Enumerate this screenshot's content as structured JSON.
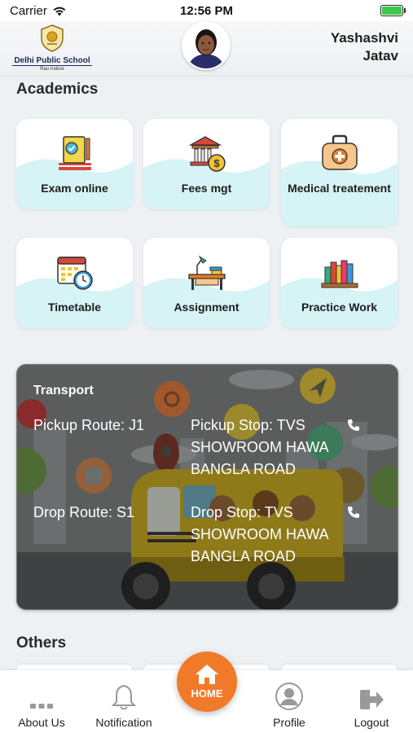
{
  "status_bar": {
    "carrier": "Carrier",
    "time": "12:56 PM"
  },
  "header": {
    "school_name": "Delhi Public School",
    "school_location": "Rau Indore",
    "user_first": "Yashashvi",
    "user_last": "Jatav"
  },
  "academics": {
    "title": "Academics",
    "items": [
      {
        "label": "Exam online",
        "icon": "exam-icon"
      },
      {
        "label": "Fees mgt",
        "icon": "fees-icon"
      },
      {
        "label": "Medical treatement",
        "icon": "medical-icon"
      },
      {
        "label": "Timetable",
        "icon": "calendar-clock-icon"
      },
      {
        "label": "Assignment",
        "icon": "desk-icon"
      },
      {
        "label": "Practice Work",
        "icon": "books-icon"
      }
    ]
  },
  "transport": {
    "title": "Transport",
    "pickup_route": "Pickup Route: J1",
    "pickup_stop": "Pickup Stop: TVS SHOWROOM HAWA BANGLA ROAD",
    "drop_route": "Drop Route: S1",
    "drop_stop": "Drop Stop: TVS SHOWROOM HAWA BANGLA ROAD"
  },
  "others": {
    "title": "Others"
  },
  "bottom_nav": {
    "about": "About Us",
    "notification": "Notification",
    "home": "HOME",
    "profile": "Profile",
    "logout": "Logout"
  },
  "colors": {
    "accent": "#f07a2a",
    "card_wave": "#d6f3f5",
    "battery": "#3ec84b"
  }
}
